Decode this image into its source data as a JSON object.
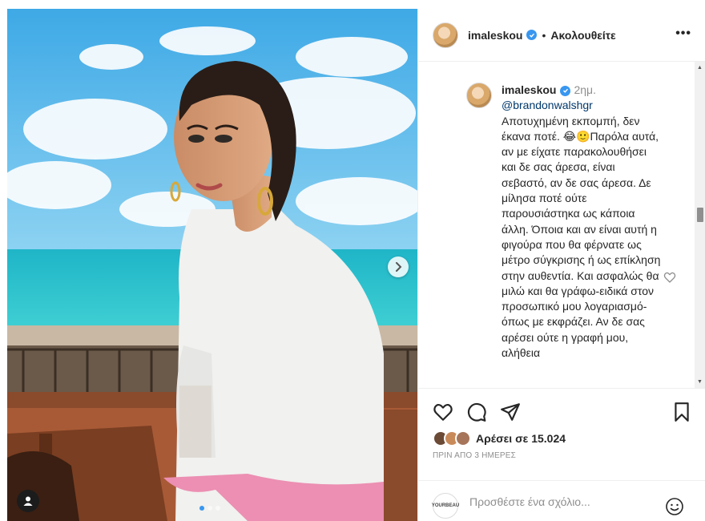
{
  "post": {
    "author": "imaleskou",
    "separator": "•",
    "follow_label": "Ακολουθείτε",
    "more_label": "•••"
  },
  "comment": {
    "user": "imaleskou",
    "time": "2ημ.",
    "mention": "@brandonwalshgr",
    "text": "Αποτυχημένη εκπομπή, δεν έκανα ποτέ. 😂🙂Παρόλα αυτά, αν με είχατε παρακολουθήσει και δε σας άρεσα, είναι σεβαστό, αν δε σας άρεσα. Δε μίλησα ποτέ ούτε παρουσιάστηκα ως κάποια άλλη. Όποια και αν είναι αυτή η φιγούρα που θα φέρνατε ως μέτρο σύγκρισης ή ως επίκληση στην αυθεντία. Και ασφαλώς θα μιλώ και θα γράφω-ειδικά στον προσωπικό μου λογαριασμό-όπως με εκφράζει. Αν δε σας αρέσει ούτε η γραφή μου, αλήθεια"
  },
  "likes_text": "Αρέσει σε 15.024",
  "date_text": "ΠΡΙΝ ΑΠΟ 3 ΗΜΕΡΕΣ",
  "add_comment": {
    "placeholder": "Προσθέστε ένα σχόλιο...",
    "brand_logo_text": "YOURBEAU"
  },
  "colors": {
    "verified": "#3897f0",
    "sky": "#6fc4ec",
    "sea": "#2cc1cc",
    "link": "#00376b",
    "muted": "#8e8e8e"
  },
  "icons": [
    "heart-icon",
    "comment-icon",
    "share-icon",
    "bookmark-icon",
    "chevron-right-icon",
    "user-tag-icon",
    "smiley-icon",
    "more-icon"
  ]
}
